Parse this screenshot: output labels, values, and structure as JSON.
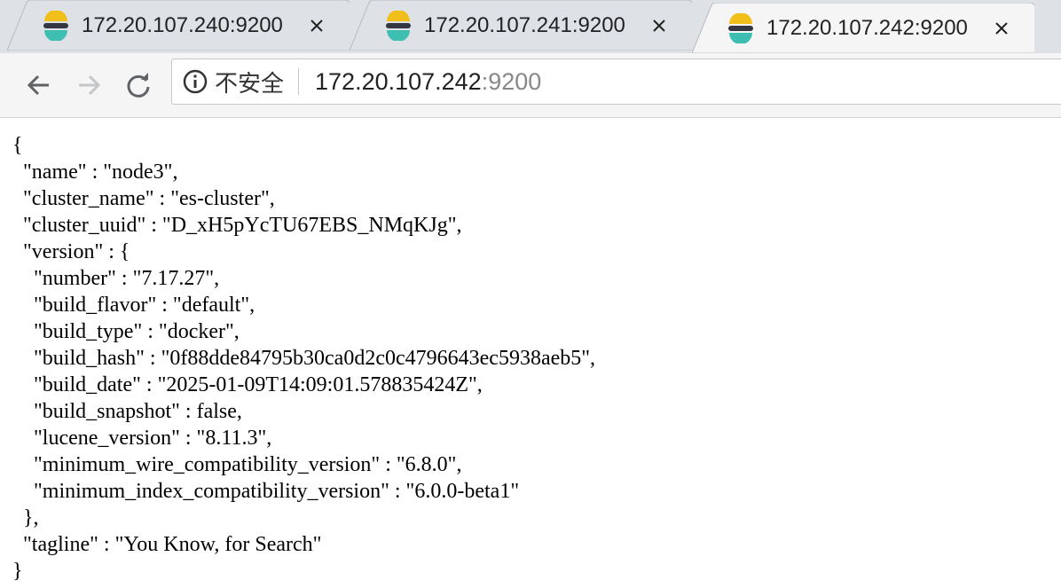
{
  "tabs": [
    {
      "title": "172.20.107.240:9200",
      "active": false
    },
    {
      "title": "172.20.107.241:9200",
      "active": false
    },
    {
      "title": "172.20.107.242:9200",
      "active": true
    }
  ],
  "toolbar": {
    "security_label": "不安全",
    "url_host": "172.20.107.242",
    "url_port": ":9200"
  },
  "json_lines": [
    "{",
    "  \"name\" : \"node3\",",
    "  \"cluster_name\" : \"es-cluster\",",
    "  \"cluster_uuid\" : \"D_xH5pYcTU67EBS_NMqKJg\",",
    "  \"version\" : {",
    "    \"number\" : \"7.17.27\",",
    "    \"build_flavor\" : \"default\",",
    "    \"build_type\" : \"docker\",",
    "    \"build_hash\" : \"0f88dde84795b30ca0d2c0c4796643ec5938aeb5\",",
    "    \"build_date\" : \"2025-01-09T14:09:01.578835424Z\",",
    "    \"build_snapshot\" : false,",
    "    \"lucene_version\" : \"8.11.3\",",
    "    \"minimum_wire_compatibility_version\" : \"6.8.0\",",
    "    \"minimum_index_compatibility_version\" : \"6.0.0-beta1\"",
    "  },",
    "  \"tagline\" : \"You Know, for Search\"",
    "}"
  ],
  "colors": {
    "tab_inactive": "#dee1e6",
    "tab_active": "#f5f5f5",
    "favicon_yellow": "#f0bf1a",
    "favicon_teal": "#3ebeb0",
    "favicon_dark": "#343741"
  }
}
